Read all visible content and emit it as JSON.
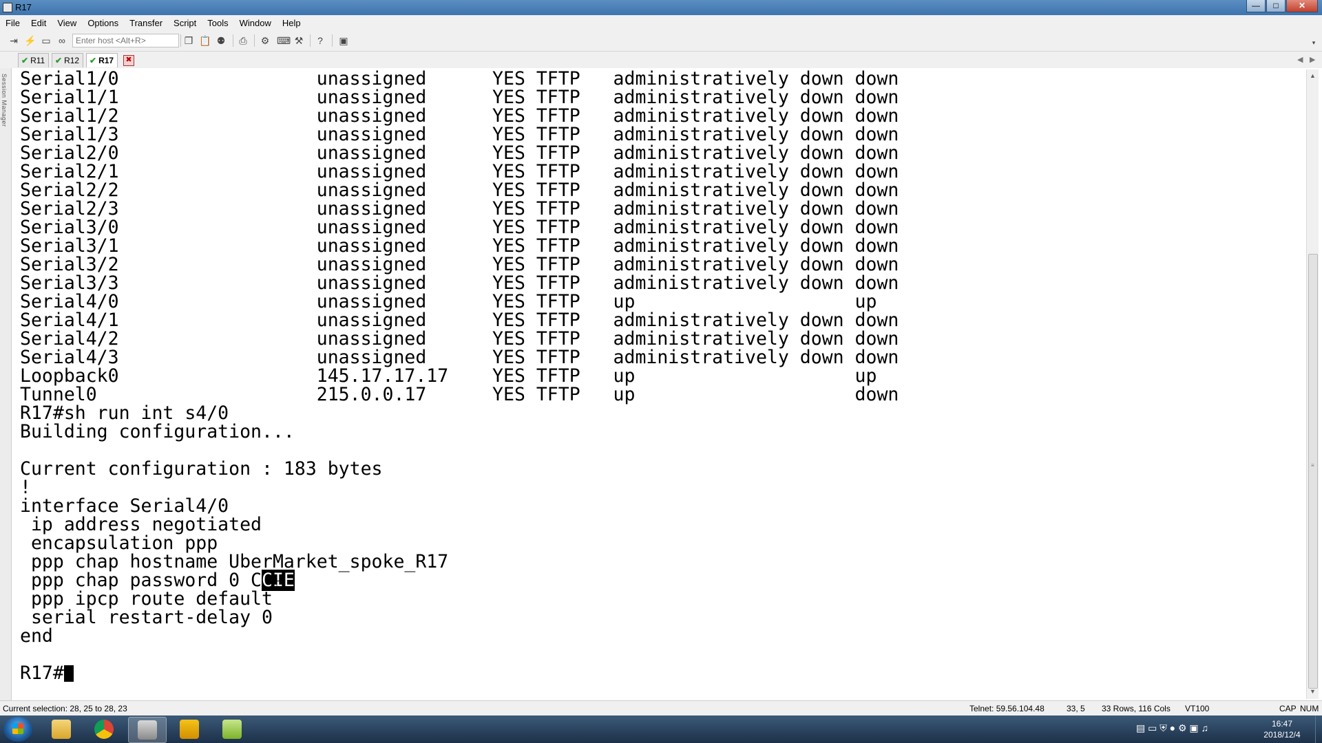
{
  "window": {
    "title": "R17",
    "controls": [
      "—",
      "□",
      "✕"
    ]
  },
  "menu": [
    "File",
    "Edit",
    "View",
    "Options",
    "Transfer",
    "Script",
    "Tools",
    "Window",
    "Help"
  ],
  "toolbar": {
    "host_placeholder": "Enter host <Alt+R>",
    "icons": [
      "connect-icon",
      "quick-connect-icon",
      "connect-in-tab-icon",
      "reconnect-icon",
      "copy-icon",
      "paste-icon",
      "find-icon",
      "print-icon",
      "settings-icon",
      "keymap-icon",
      "sftp-icon",
      "help-icon",
      "screen-icon"
    ]
  },
  "tabs": [
    {
      "label": "R11",
      "active": false,
      "status_icon": "check-icon"
    },
    {
      "label": "R12",
      "active": false,
      "status_icon": "check-icon"
    },
    {
      "label": "R17",
      "active": true,
      "status_icon": "check-icon"
    }
  ],
  "session_manager_label": "Session Manager",
  "terminal": {
    "lines": [
      "Serial1/0                  unassigned      YES TFTP   administratively down down",
      "Serial1/1                  unassigned      YES TFTP   administratively down down",
      "Serial1/2                  unassigned      YES TFTP   administratively down down",
      "Serial1/3                  unassigned      YES TFTP   administratively down down",
      "Serial2/0                  unassigned      YES TFTP   administratively down down",
      "Serial2/1                  unassigned      YES TFTP   administratively down down",
      "Serial2/2                  unassigned      YES TFTP   administratively down down",
      "Serial2/3                  unassigned      YES TFTP   administratively down down",
      "Serial3/0                  unassigned      YES TFTP   administratively down down",
      "Serial3/1                  unassigned      YES TFTP   administratively down down",
      "Serial3/2                  unassigned      YES TFTP   administratively down down",
      "Serial3/3                  unassigned      YES TFTP   administratively down down",
      "Serial4/0                  unassigned      YES TFTP   up                    up",
      "Serial4/1                  unassigned      YES TFTP   administratively down down",
      "Serial4/2                  unassigned      YES TFTP   administratively down down",
      "Serial4/3                  unassigned      YES TFTP   administratively down down",
      "Loopback0                  145.17.17.17    YES TFTP   up                    up",
      "Tunnel0                    215.0.0.17      YES TFTP   up                    down",
      "R17#sh run int s4/0",
      "Building configuration...",
      "",
      "Current configuration : 183 bytes",
      "!",
      "interface Serial4/0",
      " ip address negotiated",
      " encapsulation ppp",
      " ppp chap hostname UberMarket_spoke_R17",
      " ppp chap password 0 CCIE",
      " ppp ipcp route default",
      " serial restart-delay 0",
      "end",
      "",
      "R17#"
    ],
    "selection": {
      "line": 27,
      "prefix": " ppp chap password 0 C",
      "selected": "CIE"
    }
  },
  "status": {
    "selection": "Current selection: 28, 25 to 28, 23",
    "connection": "Telnet: 59.56.104.48",
    "cursor": "33,  5",
    "size": "33 Rows, 116 Cols",
    "emulation": "VT100",
    "cap": "CAP",
    "num": "NUM"
  },
  "taskbar": {
    "apps": [
      "explorer-icon",
      "chrome-icon",
      "securecrt-icon",
      "app-icon",
      "notepad-icon"
    ],
    "clock_time": "16:47",
    "clock_date": "2018/12/4"
  }
}
